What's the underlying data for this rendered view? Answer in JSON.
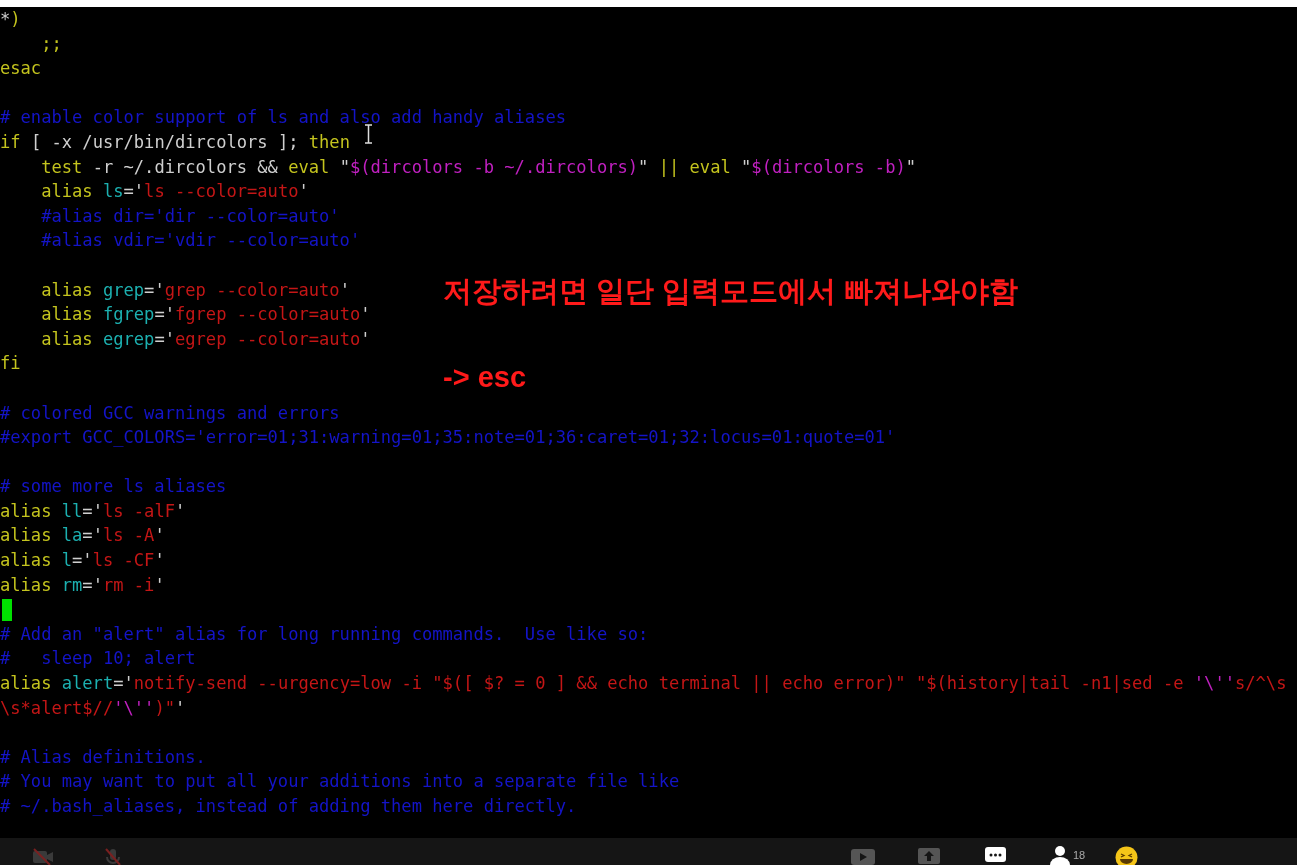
{
  "editor": {
    "lines": [
      {
        "cursor": false,
        "segments": [
          {
            "kind": "plain",
            "text": "*"
          },
          {
            "kind": "keyword",
            "text": ")"
          }
        ]
      },
      {
        "cursor": false,
        "segments": [
          {
            "kind": "keyword",
            "text": "    ;;"
          }
        ]
      },
      {
        "cursor": false,
        "segments": [
          {
            "kind": "keyword",
            "text": "esac"
          }
        ]
      },
      {
        "cursor": false
      },
      {
        "cursor": false,
        "segments": [
          {
            "kind": "comment",
            "text": "# enable color support of ls and also add handy aliases"
          }
        ]
      },
      {
        "cursor": false,
        "segments": [
          {
            "kind": "keyword",
            "text": "if"
          },
          {
            "kind": "plain",
            "text": " [ -x /usr/bin/dircolors ]; "
          },
          {
            "kind": "keyword",
            "text": "then"
          }
        ]
      },
      {
        "cursor": false,
        "segments": [
          {
            "kind": "keyword",
            "text": "    test"
          },
          {
            "kind": "plain",
            "text": " -r ~/.dircolors && "
          },
          {
            "kind": "keyword",
            "text": "eval"
          },
          {
            "kind": "plain",
            "text": " \""
          },
          {
            "kind": "special",
            "text": "$(dircolors -b ~/.dircolors)"
          },
          {
            "kind": "plain",
            "text": "\" "
          },
          {
            "kind": "keyword",
            "text": "|| eval"
          },
          {
            "kind": "plain",
            "text": " \""
          },
          {
            "kind": "special",
            "text": "$(dircolors -b)"
          },
          {
            "kind": "plain",
            "text": "\""
          }
        ]
      },
      {
        "cursor": false,
        "segments": [
          {
            "kind": "keyword",
            "text": "    alias "
          },
          {
            "kind": "identifier",
            "text": "ls"
          },
          {
            "kind": "plain",
            "text": "='"
          },
          {
            "kind": "string",
            "text": "ls --color=auto"
          },
          {
            "kind": "plain",
            "text": "'"
          }
        ]
      },
      {
        "cursor": false,
        "segments": [
          {
            "kind": "comment",
            "text": "    #alias dir='dir --color=auto'"
          }
        ]
      },
      {
        "cursor": false,
        "segments": [
          {
            "kind": "comment",
            "text": "    #alias vdir='vdir --color=auto'"
          }
        ]
      },
      {
        "cursor": false
      },
      {
        "cursor": false,
        "segments": [
          {
            "kind": "keyword",
            "text": "    alias "
          },
          {
            "kind": "identifier",
            "text": "grep"
          },
          {
            "kind": "plain",
            "text": "='"
          },
          {
            "kind": "string",
            "text": "grep --color=auto"
          },
          {
            "kind": "plain",
            "text": "'"
          }
        ]
      },
      {
        "cursor": false,
        "segments": [
          {
            "kind": "keyword",
            "text": "    alias "
          },
          {
            "kind": "identifier",
            "text": "fgrep"
          },
          {
            "kind": "plain",
            "text": "='"
          },
          {
            "kind": "string",
            "text": "fgrep --color=auto"
          },
          {
            "kind": "plain",
            "text": "'"
          }
        ]
      },
      {
        "cursor": false,
        "segments": [
          {
            "kind": "keyword",
            "text": "    alias "
          },
          {
            "kind": "identifier",
            "text": "egrep"
          },
          {
            "kind": "plain",
            "text": "='"
          },
          {
            "kind": "string",
            "text": "egrep --color=auto"
          },
          {
            "kind": "plain",
            "text": "'"
          }
        ]
      },
      {
        "cursor": false,
        "segments": [
          {
            "kind": "keyword",
            "text": "fi"
          }
        ]
      },
      {
        "cursor": false
      },
      {
        "cursor": false,
        "segments": [
          {
            "kind": "comment",
            "text": "# colored GCC warnings and errors"
          }
        ]
      },
      {
        "cursor": false,
        "segments": [
          {
            "kind": "comment",
            "text": "#export GCC_COLORS='error=01;31:warning=01;35:note=01;36:caret=01;32:locus=01:quote=01'"
          }
        ]
      },
      {
        "cursor": false
      },
      {
        "cursor": false,
        "segments": [
          {
            "kind": "comment",
            "text": "# some more ls aliases"
          }
        ]
      },
      {
        "cursor": false,
        "segments": [
          {
            "kind": "keyword",
            "text": "alias "
          },
          {
            "kind": "identifier",
            "text": "ll"
          },
          {
            "kind": "plain",
            "text": "='"
          },
          {
            "kind": "string",
            "text": "ls -alF"
          },
          {
            "kind": "plain",
            "text": "'"
          }
        ]
      },
      {
        "cursor": false,
        "segments": [
          {
            "kind": "keyword",
            "text": "alias "
          },
          {
            "kind": "identifier",
            "text": "la"
          },
          {
            "kind": "plain",
            "text": "='"
          },
          {
            "kind": "string",
            "text": "ls -A"
          },
          {
            "kind": "plain",
            "text": "'"
          }
        ]
      },
      {
        "cursor": false,
        "segments": [
          {
            "kind": "keyword",
            "text": "alias "
          },
          {
            "kind": "identifier",
            "text": "l"
          },
          {
            "kind": "plain",
            "text": "='"
          },
          {
            "kind": "string",
            "text": "ls -CF"
          },
          {
            "kind": "plain",
            "text": "'"
          }
        ]
      },
      {
        "cursor": false,
        "segments": [
          {
            "kind": "keyword",
            "text": "alias "
          },
          {
            "kind": "identifier",
            "text": "rm"
          },
          {
            "kind": "plain",
            "text": "='"
          },
          {
            "kind": "string",
            "text": "rm -i"
          },
          {
            "kind": "plain",
            "text": "'"
          }
        ]
      },
      {
        "cursor": true
      },
      {
        "cursor": false,
        "segments": [
          {
            "kind": "comment",
            "text": "# Add an \"alert\" alias for long running commands.  Use like so:"
          }
        ]
      },
      {
        "cursor": false,
        "segments": [
          {
            "kind": "comment",
            "text": "#   sleep 10; alert"
          }
        ]
      },
      {
        "cursor": false,
        "segments": [
          {
            "kind": "keyword",
            "text": "alias "
          },
          {
            "kind": "identifier",
            "text": "alert"
          },
          {
            "kind": "plain",
            "text": "='"
          },
          {
            "kind": "string",
            "text": "notify-send --urgency=low -i \"$([ $? = 0 ] && echo terminal || echo error)\" \"$(history|tail -n1|sed -e "
          },
          {
            "kind": "special",
            "text": "'\\''"
          },
          {
            "kind": "string",
            "text": "s/^\\s"
          }
        ]
      },
      {
        "cursor": false,
        "segments": [
          {
            "kind": "string",
            "text": "\\s*alert$//"
          },
          {
            "kind": "special",
            "text": "'\\''"
          },
          {
            "kind": "string",
            "text": ")\""
          },
          {
            "kind": "plain",
            "text": "'"
          }
        ]
      },
      {
        "cursor": false
      },
      {
        "cursor": false,
        "segments": [
          {
            "kind": "comment",
            "text": "# Alias definitions."
          }
        ]
      },
      {
        "cursor": false,
        "segments": [
          {
            "kind": "comment",
            "text": "# You may want to put all your additions into a separate file like"
          }
        ]
      },
      {
        "cursor": false,
        "segments": [
          {
            "kind": "comment",
            "text": "# ~/.bash_aliases, instead of adding them here directly."
          }
        ]
      }
    ]
  },
  "annotation": {
    "lines": [
      "저장하려면 일단 입력모드에서 빠져나와야함",
      "-> esc"
    ]
  },
  "call_bar": {
    "participants_count": "18"
  }
}
